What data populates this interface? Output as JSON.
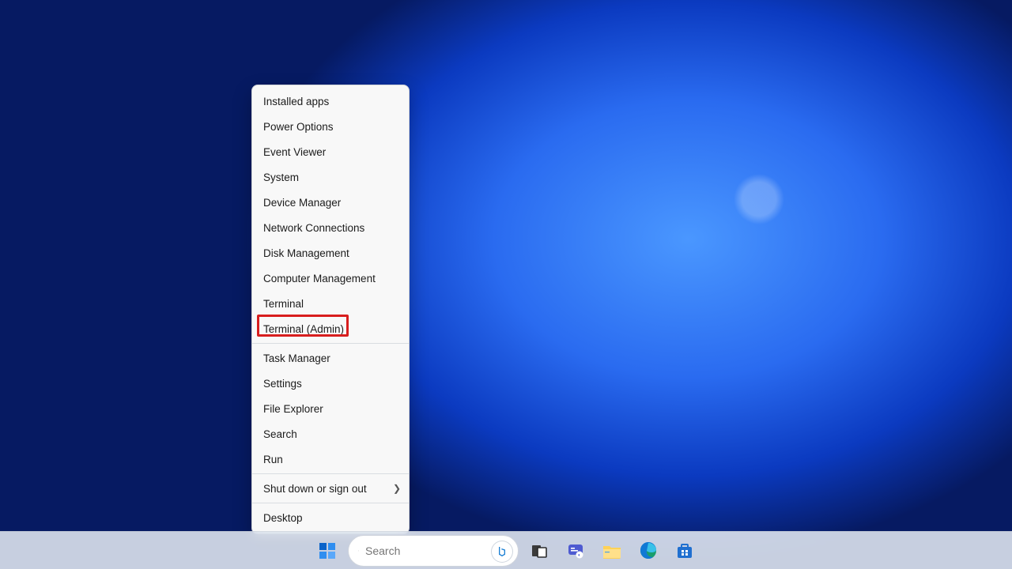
{
  "context_menu": {
    "items_group1": [
      {
        "label": "Installed apps"
      },
      {
        "label": "Power Options"
      },
      {
        "label": "Event Viewer"
      },
      {
        "label": "System"
      },
      {
        "label": "Device Manager"
      },
      {
        "label": "Network Connections"
      },
      {
        "label": "Disk Management"
      },
      {
        "label": "Computer Management"
      },
      {
        "label": "Terminal"
      },
      {
        "label": "Terminal (Admin)"
      }
    ],
    "items_group2": [
      {
        "label": "Task Manager"
      },
      {
        "label": "Settings"
      },
      {
        "label": "File Explorer"
      },
      {
        "label": "Search"
      },
      {
        "label": "Run"
      }
    ],
    "items_group3": [
      {
        "label": "Shut down or sign out",
        "submenu": true
      }
    ],
    "items_group4": [
      {
        "label": "Desktop"
      }
    ],
    "highlighted_item_label": "Terminal (Admin)"
  },
  "taskbar": {
    "search_placeholder": "Search",
    "icons": [
      {
        "name": "start-icon",
        "tip": "Start"
      },
      {
        "name": "search-icon",
        "tip": "Search"
      },
      {
        "name": "task-view-icon",
        "tip": "Task View"
      },
      {
        "name": "chat-icon",
        "tip": "Chat"
      },
      {
        "name": "file-explorer-icon",
        "tip": "File Explorer"
      },
      {
        "name": "edge-icon",
        "tip": "Microsoft Edge"
      },
      {
        "name": "store-icon",
        "tip": "Microsoft Store"
      }
    ]
  },
  "annotation": {
    "highlight_target": "Terminal (Admin)",
    "highlight_color": "#d81e1e"
  }
}
